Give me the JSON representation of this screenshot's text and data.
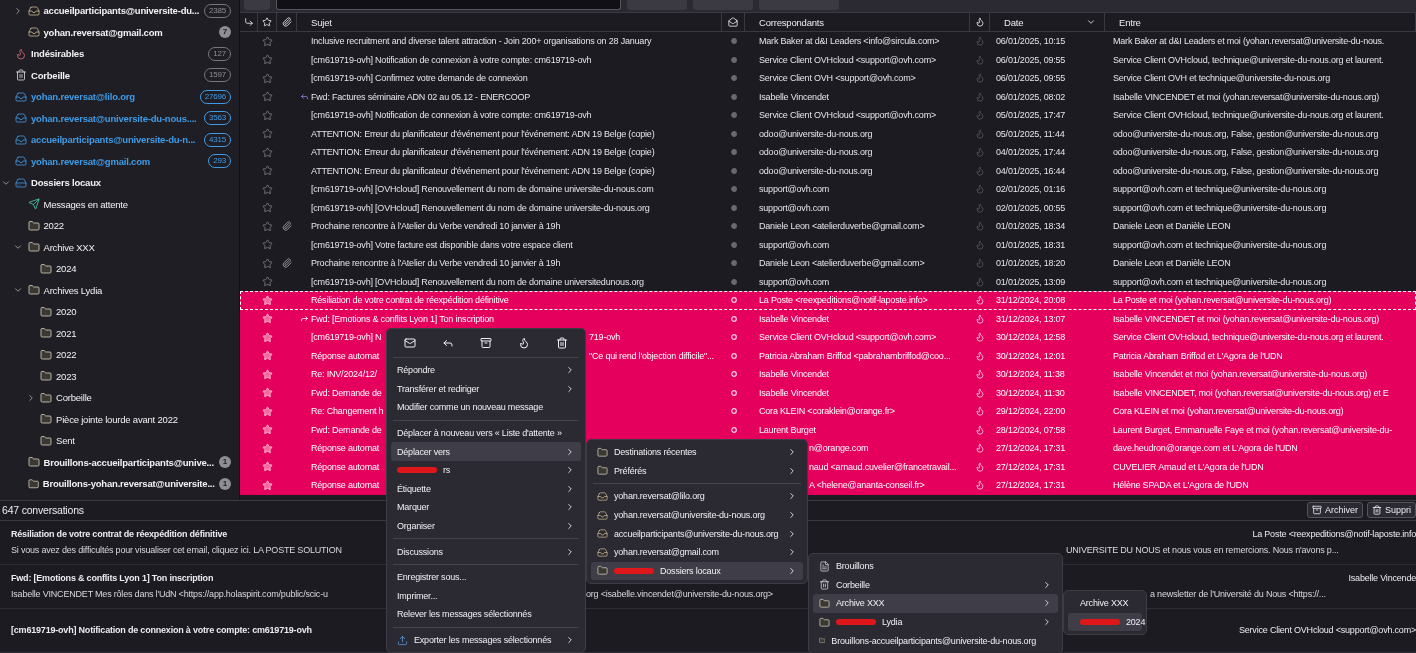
{
  "sidebar": {
    "account_items": [
      {
        "label": "accueilparticipants@universite-du...",
        "kind": "account",
        "count": "2385",
        "count_filled": false,
        "unread": true,
        "expanded": false
      },
      {
        "label": "yohan.reversat@gmail.com",
        "kind": "account",
        "count": "7",
        "count_filled": true,
        "unread": true
      }
    ],
    "items": [
      {
        "label": "Indésirables",
        "kind": "junk",
        "count": "127",
        "count_filled": false,
        "unread": true
      },
      {
        "label": "Corbeille",
        "kind": "trash",
        "count": "1597",
        "count_filled": false,
        "unread": true
      },
      {
        "label": "yohan.reversat@lilo.org",
        "kind": "inbox",
        "count": "27696",
        "count_filled": false,
        "unread": true
      },
      {
        "label": "yohan.reversat@universite-du-nous....",
        "kind": "inbox",
        "count": "3563",
        "count_filled": false,
        "unread": true
      },
      {
        "label": "accueilparticipants@universite-du-n...",
        "kind": "inbox",
        "count": "4315",
        "count_filled": false,
        "unread": true
      },
      {
        "label": "yohan.reversat@gmail.com",
        "kind": "inbox",
        "count": "293",
        "count_filled": false,
        "unread": true
      },
      {
        "label": "Dossiers locaux",
        "kind": "local",
        "unread": true,
        "expanded": true,
        "children": [
          {
            "label": "Messages en attente",
            "kind": "outbox",
            "unread": false
          },
          {
            "label": "2022",
            "kind": "folder",
            "unread": false
          },
          {
            "label": "Archive XXX",
            "kind": "folder",
            "unread": false,
            "expanded": true,
            "children": [
              {
                "label": "2024",
                "kind": "folder",
                "unread": false
              }
            ]
          },
          {
            "label": "Archives Lydia",
            "kind": "folder",
            "unread": false,
            "expanded": true,
            "children": [
              {
                "label": "2020",
                "kind": "folder",
                "unread": false
              },
              {
                "label": "2021",
                "kind": "folder",
                "unread": false
              },
              {
                "label": "2022",
                "kind": "folder",
                "unread": false
              },
              {
                "label": "2023",
                "kind": "folder",
                "unread": false
              },
              {
                "label": "Corbeille",
                "kind": "folder",
                "unread": false,
                "expanded": false
              },
              {
                "label": "Pièce jointe lourde avant 2022",
                "kind": "folder",
                "unread": false
              },
              {
                "label": "Sent",
                "kind": "folder",
                "unread": false
              }
            ]
          },
          {
            "label": "Brouillons-accueilparticipants@unive...",
            "kind": "folder",
            "count": "1",
            "count_filled": true,
            "unread": true
          },
          {
            "label": "Brouillons-yohan.reversat@universite...",
            "kind": "folder",
            "count": "1",
            "count_filled": true,
            "unread": true
          }
        ]
      }
    ]
  },
  "message_list": {
    "columns": [
      {
        "kind": "thread"
      },
      {
        "kind": "star"
      },
      {
        "kind": "attachment"
      },
      {
        "kind": "text",
        "label": "Sujet"
      },
      {
        "kind": "read"
      },
      {
        "kind": "text",
        "label": "Correspondants"
      },
      {
        "kind": "junk"
      },
      {
        "kind": "text",
        "label": "Date",
        "sorted": true
      },
      {
        "kind": "text",
        "label": "Entre"
      }
    ],
    "rows": [
      {
        "subject": "Inclusive recruitment and diverse talent attraction - Join 200+ organisations on 28 January",
        "correspondent": "Mark Baker at d&I Leaders <info@sircula.com>",
        "date": "06/01/2025, 10:15",
        "recipients": "Mark Baker at d&I Leaders et moi (yohan.reversat@universite-du-nous.",
        "attachment": false,
        "replied": false,
        "forwarded": false,
        "selected": false,
        "focused": false
      },
      {
        "subject": "[cm619719-ovh] Notification de connexion à votre compte: cm619719-ovh",
        "correspondent": "Service Client OVHcloud <support@ovh.com>",
        "date": "06/01/2025, 09:55",
        "recipients": "Service Client OVHcloud, technique@universite-du-nous.org et laurent.",
        "attachment": false,
        "replied": false,
        "forwarded": false,
        "selected": false,
        "focused": false
      },
      {
        "subject": "[cm619719-ovh] Confirmez votre demande de connexion",
        "correspondent": "Service Client OVH <support@ovh.com>",
        "date": "06/01/2025, 09:55",
        "recipients": "Service Client OVH et technique@universite-du-nous.org",
        "attachment": false,
        "replied": false,
        "forwarded": false,
        "selected": false,
        "focused": false
      },
      {
        "subject": "Fwd: Factures séminaire ADN 02 au 05.12 - ENERCOOP",
        "correspondent": "Isabelle Vincendet",
        "date": "06/01/2025, 08:02",
        "recipients": "Isabelle VINCENDET et moi (yohan.reversat@universite-du-nous.org)",
        "attachment": false,
        "replied": true,
        "forwarded": false,
        "selected": false,
        "focused": false
      },
      {
        "subject": "[cm619719-ovh] Notification de connexion à votre compte: cm619719-ovh",
        "correspondent": "Service Client OVHcloud <support@ovh.com>",
        "date": "05/01/2025, 17:47",
        "recipients": "Service Client OVHcloud, technique@universite-du-nous.org et laurent.",
        "attachment": false,
        "replied": false,
        "forwarded": false,
        "selected": false,
        "focused": false
      },
      {
        "subject": "ATTENTION: Erreur du planificateur d'événement pour l'événement: ADN 19 Belge (copie)",
        "correspondent": "odoo@universite-du-nous.org",
        "date": "05/01/2025, 11:44",
        "recipients": "odoo@universite-du-nous.org, False, gestion@universite-du-nous.org",
        "attachment": false,
        "replied": false,
        "forwarded": false,
        "selected": false,
        "focused": false
      },
      {
        "subject": "ATTENTION: Erreur du planificateur d'événement pour l'événement: ADN 19 Belge (copie)",
        "correspondent": "odoo@universite-du-nous.org",
        "date": "04/01/2025, 17:44",
        "recipients": "odoo@universite-du-nous.org, False, gestion@universite-du-nous.org",
        "attachment": false,
        "replied": false,
        "forwarded": false,
        "selected": false,
        "focused": false
      },
      {
        "subject": "ATTENTION: Erreur du planificateur d'événement pour l'événement: ADN 19 Belge (copie)",
        "correspondent": "odoo@universite-du-nous.org",
        "date": "04/01/2025, 16:44",
        "recipients": "odoo@universite-du-nous.org, False, gestion@universite-du-nous.org",
        "attachment": false,
        "replied": false,
        "forwarded": false,
        "selected": false,
        "focused": false
      },
      {
        "subject": "[cm619719-ovh] [OVHcloud] Renouvellement du nom de domaine universite-du-nous.com",
        "correspondent": "support@ovh.com",
        "date": "02/01/2025, 01:16",
        "recipients": "support@ovh.com et technique@universite-du-nous.org",
        "attachment": false,
        "replied": false,
        "forwarded": false,
        "selected": false,
        "focused": false
      },
      {
        "subject": "[cm619719-ovh] [OVHcloud] Renouvellement du nom de domaine universite-du-nous.org",
        "correspondent": "support@ovh.com",
        "date": "02/01/2025, 00:55",
        "recipients": "support@ovh.com et technique@universite-du-nous.org",
        "attachment": false,
        "replied": false,
        "forwarded": false,
        "selected": false,
        "focused": false
      },
      {
        "subject": "Prochaine rencontre à l'Atelier du Verbe vendredi 10 janvier à 19h",
        "correspondent": "Daniele Leon <atelierduverbe@gmail.com>",
        "date": "01/01/2025, 18:34",
        "recipients": "Daniele Leon et Danièle LEON",
        "attachment": true,
        "replied": false,
        "forwarded": false,
        "selected": false,
        "focused": false
      },
      {
        "subject": "[cm619719-ovh] Votre facture est disponible dans votre espace client",
        "correspondent": "support@ovh.com",
        "date": "01/01/2025, 18:31",
        "recipients": "support@ovh.com et technique@universite-du-nous.org",
        "attachment": false,
        "replied": false,
        "forwarded": false,
        "selected": false,
        "focused": false
      },
      {
        "subject": "Prochaine rencontre à l'Atelier du Verbe vendredi 10 janvier à 19h",
        "correspondent": "Daniele Leon <atelierduverbe@gmail.com>",
        "date": "01/01/2025, 18:20",
        "recipients": "Daniele Leon et Danièle LEON",
        "attachment": true,
        "replied": false,
        "forwarded": false,
        "selected": false,
        "focused": false
      },
      {
        "subject": "[cm619719-ovh] [OVHcloud] Renouvellement du nom de domaine universitedunous.org",
        "correspondent": "support@ovh.com",
        "date": "01/01/2025, 13:09",
        "recipients": "support@ovh.com et technique@universite-du-nous.org",
        "attachment": false,
        "replied": false,
        "forwarded": false,
        "selected": false,
        "focused": false
      },
      {
        "subject": "Résiliation de votre contrat de réexpédition définitive",
        "correspondent": "La Poste <reexpeditions@notif-laposte.info>",
        "date": "31/12/2024, 20:08",
        "recipients": "La Poste et moi (yohan.reversat@universite-du-nous.org)",
        "attachment": false,
        "replied": false,
        "forwarded": false,
        "selected": true,
        "focused": true
      },
      {
        "subject": "Fwd: [Emotions & conflits Lyon 1] Ton inscription",
        "correspondent": "Isabelle Vincendet",
        "date": "31/12/2024, 13:07",
        "recipients": "Isabelle VINCENDET et moi (yohan.reversat@universite-du-nous.org)",
        "attachment": false,
        "replied": false,
        "forwarded": true,
        "selected": true,
        "focused": false
      },
      {
        "subject": "[cm619719-ovh] N",
        "subject_tail": "719-ovh",
        "correspondent": "Service Client OVHcloud <support@ovh.com>",
        "date": "30/12/2024, 12:58",
        "recipients": "Service Client OVHcloud, technique@universite-du-nous.org et laurent.",
        "attachment": false,
        "replied": false,
        "forwarded": false,
        "selected": true,
        "focused": false
      },
      {
        "subject": "Réponse automat",
        "subject_tail": "\"Ce qui rend l'objection difficile\"...",
        "correspondent": "Patricia Abraham Briffod <pabrahambriffod@coo...",
        "date": "30/12/2024, 12:01",
        "recipients": "Patricia Abraham Briffod et L'Agora de l'UDN",
        "attachment": false,
        "replied": false,
        "forwarded": false,
        "selected": true,
        "focused": false
      },
      {
        "subject": "Re: INV/2024/12/",
        "correspondent": "Isabelle Vincendet",
        "date": "30/12/2024, 11:38",
        "recipients": "Isabelle Vincendet et moi (yohan.reversat@universite-du-nous.org)",
        "attachment": false,
        "replied": false,
        "forwarded": false,
        "selected": true,
        "focused": false
      },
      {
        "subject": "Fwd: Demande de",
        "correspondent": "Isabelle Vincendet",
        "date": "30/12/2024, 11:30",
        "recipients": "Isabelle VINCENDET, moi (yohan.reversat@universite-du-nous.org) et E",
        "attachment": false,
        "replied": false,
        "forwarded": false,
        "selected": true,
        "focused": false
      },
      {
        "subject": "Re: Changement h",
        "correspondent": "Cora KLEIN <coraklein@orange.fr>",
        "date": "29/12/2024, 22:00",
        "recipients": "Cora KLEIN et moi (yohan.reversat@universite-du-nous.org)",
        "attachment": false,
        "replied": false,
        "forwarded": false,
        "selected": true,
        "focused": false
      },
      {
        "subject": "Fwd: Demande de",
        "correspondent": "Laurent Burget",
        "date": "28/12/2024, 07:58",
        "recipients": "Laurent Burget, Emmanuelle Faye et moi (yohan.reversat@universite-du-",
        "attachment": false,
        "replied": false,
        "forwarded": false,
        "selected": true,
        "focused": false
      },
      {
        "subject": "Réponse automat",
        "correspondent_tail": "n@orange.com",
        "date": "27/12/2024, 17:31",
        "recipients": "dave.heudron@orange.com et L'Agora de l'UDN",
        "attachment": false,
        "replied": false,
        "forwarded": false,
        "selected": true,
        "focused": false
      },
      {
        "subject": "Réponse automat",
        "correspondent_tail": "naud <arnaud.cuvelier@francetravail...",
        "date": "27/12/2024, 17:31",
        "recipients": "CUVELIER Arnaud et L'Agora de l'UDN",
        "attachment": false,
        "replied": false,
        "forwarded": false,
        "selected": true,
        "focused": false
      },
      {
        "subject": "Réponse automat",
        "correspondent_tail": "A <helene@ananta-conseil.fr>",
        "date": "27/12/2024, 17:31",
        "recipients": "Hélène SPADA et L'Agora de l'UDN",
        "attachment": false,
        "replied": false,
        "forwarded": false,
        "selected": true,
        "focused": false
      }
    ]
  },
  "preview": {
    "count": "647 conversations",
    "buttons": [
      {
        "label": "Archiver",
        "kind": "archive"
      },
      {
        "label": "Suppri",
        "kind": "delete"
      }
    ],
    "messages": [
      {
        "subject": "Résiliation de votre contrat de réexpédition définitive",
        "sender": "La Poste <reexpeditions@notif-laposte.info",
        "snippet": "Si vous avez des difficultés pour visualiser cet email, cliquez ici. LA POSTE SOLUTION",
        "snippet_end": "UNIVERSITE DU NOUS et nous vous en remercions. Nous n'avons p..."
      },
      {
        "subject": "Fwd: [Emotions & conflits Lyon 1] Ton inscription",
        "sender": "Isabelle Vincende",
        "snippet": "Isabelle VINCENDET Mes rôles dans l'UdN <https://app.holaspirit.com/public/scic-u",
        "snippet_middle": "org <isabelle.vincendet@universite-du-nous.org>",
        "snippet_end": "a newsletter de l'Université du Nous <https://..."
      },
      {
        "subject": "[cm619719-ovh] Notification de connexion à votre compte: cm619719-ovh",
        "sender": "Service Client OVHcloud <support@ovh.com>"
      }
    ]
  },
  "context_menu": {
    "groups": [
      [
        {
          "label": "Répondre",
          "kind": "text",
          "submenu": true,
          "selected": false
        },
        {
          "label": "Transférer et rediriger",
          "kind": "text",
          "submenu": true,
          "selected": false
        },
        {
          "label": "Modifier comme un nouveau message",
          "kind": "text",
          "submenu": false,
          "selected": false
        }
      ],
      [
        {
          "label": "Déplacer à nouveau vers « Liste d'attente »",
          "kind": "text",
          "submenu": false,
          "selected": false
        },
        {
          "label": "Déplacer vers",
          "kind": "text",
          "submenu": true,
          "selected": true
        },
        {
          "label": "rs",
          "kind": "text",
          "submenu": true,
          "selected": false,
          "scribble": true
        },
        {
          "label": "Étiquette",
          "kind": "text",
          "submenu": true,
          "selected": false
        },
        {
          "label": "Marquer",
          "kind": "text",
          "submenu": true,
          "selected": false
        },
        {
          "label": "Organiser",
          "kind": "text",
          "submenu": true,
          "selected": false
        }
      ],
      [
        {
          "label": "Discussions",
          "kind": "text",
          "submenu": true,
          "selected": false
        }
      ],
      [
        {
          "label": "Enregistrer sous...",
          "kind": "text",
          "submenu": false,
          "selected": false
        },
        {
          "label": "Imprimer...",
          "kind": "text",
          "submenu": false,
          "selected": false
        },
        {
          "label": "Relever les messages sélectionnés",
          "kind": "text",
          "submenu": false,
          "selected": false
        }
      ],
      [
        {
          "label": "Exporter les messages sélectionnés",
          "kind": "export",
          "submenu": true,
          "selected": false
        }
      ]
    ]
  },
  "submenus": [
    {
      "groups": [
        [
          {
            "label": "Destinations récentes",
            "kind": "folder",
            "submenu": true,
            "selected": false
          },
          {
            "label": "Préférés",
            "kind": "folder",
            "submenu": true,
            "selected": false
          }
        ],
        [
          {
            "label": "yohan.reversat@lilo.org",
            "kind": "account",
            "submenu": true,
            "selected": false
          },
          {
            "label": "yohan.reversat@universite-du-nous.org",
            "kind": "account",
            "submenu": true,
            "selected": false
          },
          {
            "label": "accueilparticipants@universite-du-nous.org",
            "kind": "account",
            "submenu": true,
            "selected": false
          },
          {
            "label": "yohan.reversat@gmail.com",
            "kind": "account",
            "submenu": true,
            "selected": false
          },
          {
            "label": "Dossiers locaux",
            "kind": "folder",
            "submenu": true,
            "selected": true,
            "scribble": true
          }
        ]
      ]
    },
    {
      "groups": [
        [
          {
            "label": "Brouillons",
            "kind": "drafts",
            "submenu": false,
            "selected": false
          },
          {
            "label": "Corbeille",
            "kind": "trash",
            "submenu": true,
            "selected": false
          },
          {
            "label": "Archive XXX",
            "kind": "folder",
            "submenu": true,
            "selected": true
          },
          {
            "label": "Lydia",
            "kind": "folder",
            "submenu": true,
            "selected": false,
            "scribble": true
          },
          {
            "label": "Brouillons-accueilparticipants@universite-du-nous.org",
            "kind": "folder",
            "submenu": false,
            "selected": false
          }
        ]
      ]
    },
    {
      "groups": [
        [
          {
            "label": "Archive XXX",
            "kind": "folder",
            "submenu": false,
            "selected": false
          },
          {
            "label": "2024",
            "kind": "folder",
            "submenu": false,
            "selected": true,
            "scribble": true
          }
        ]
      ]
    }
  ]
}
